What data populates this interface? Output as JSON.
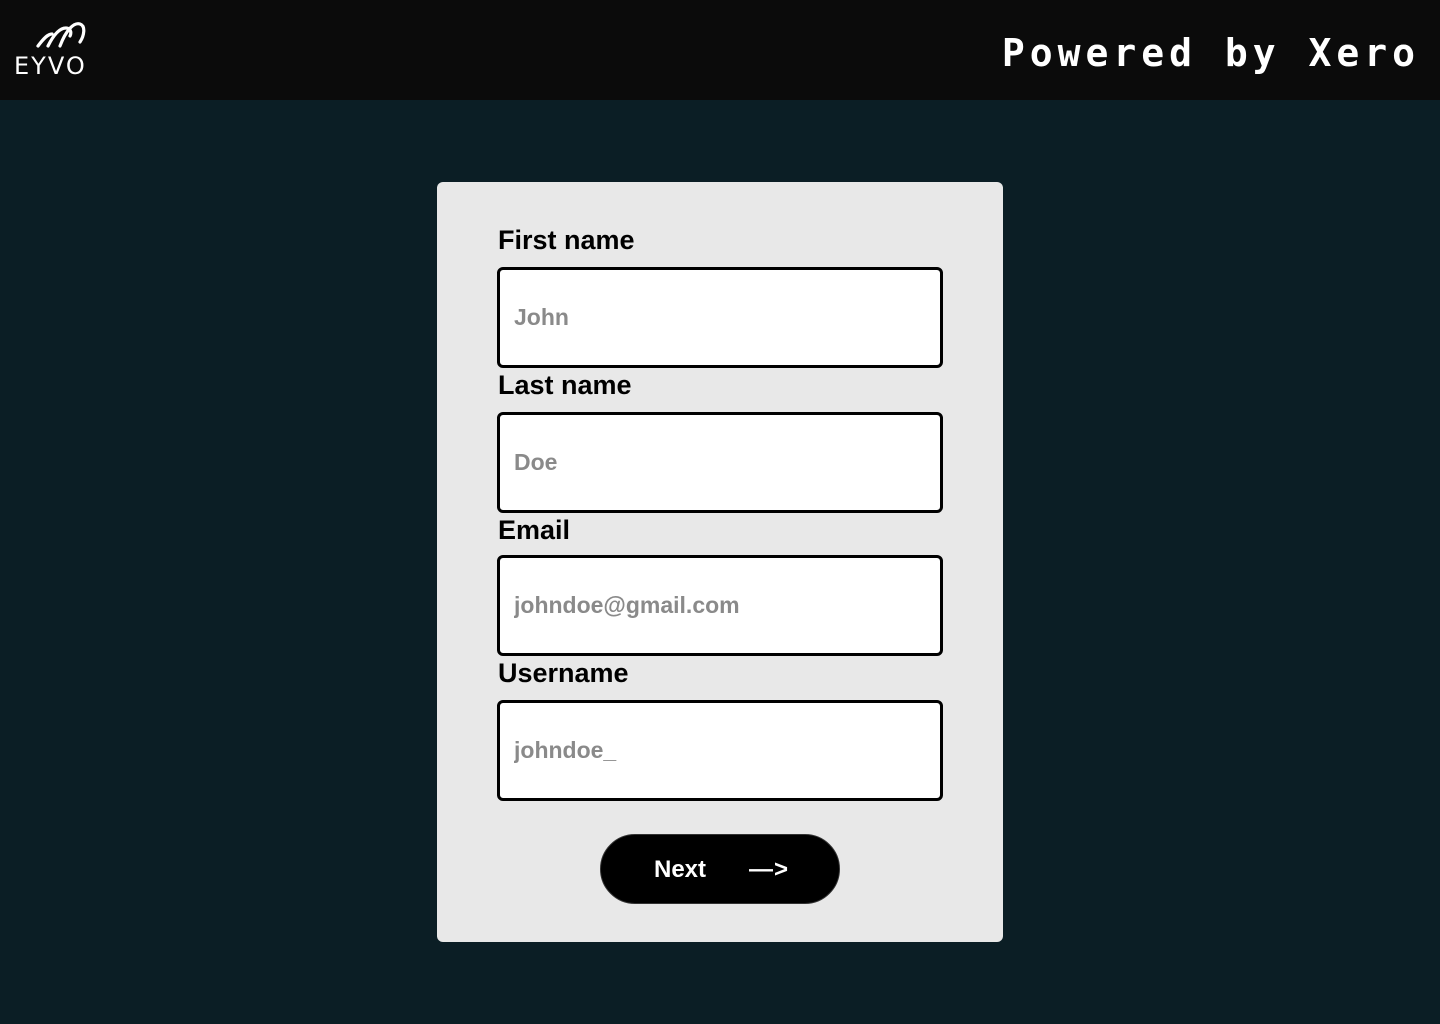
{
  "header": {
    "logo_text": "EYVO",
    "powered_by": "Powered by Xero"
  },
  "form": {
    "fields": [
      {
        "label": "First name",
        "placeholder": "John"
      },
      {
        "label": "Last name",
        "placeholder": "Doe"
      },
      {
        "label": "Email",
        "placeholder": "johndoe@gmail.com"
      },
      {
        "label": "Username",
        "placeholder": "johndoe_"
      }
    ],
    "next_label": "Next",
    "next_arrow": "—>"
  },
  "colors": {
    "page_background": "#0b1e25",
    "header_background": "#0b0b0b",
    "card_background": "#e8e8e8",
    "button_background": "#000000"
  },
  "icons": {
    "logo": "eyvo-wave-logo",
    "next_arrow": "arrow-right-icon"
  }
}
